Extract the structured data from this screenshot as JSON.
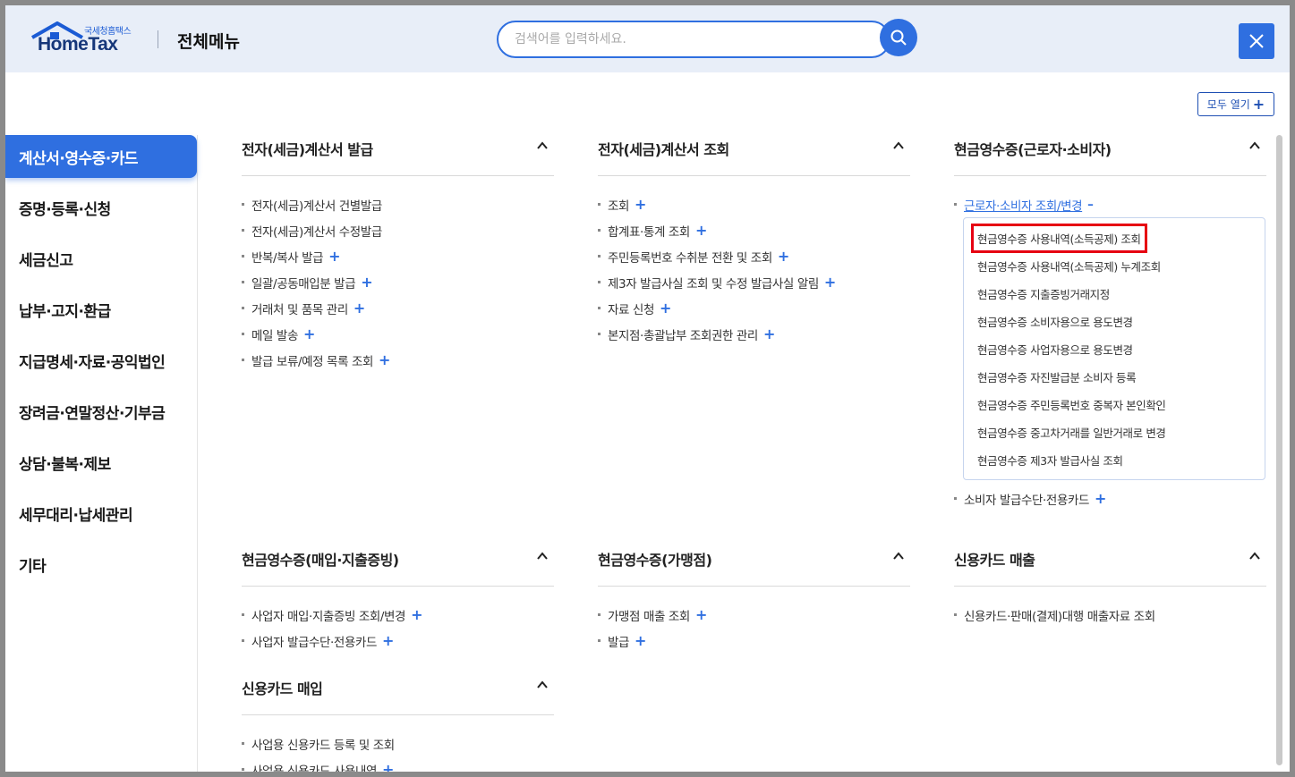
{
  "header": {
    "logo_small": "국세청홈택스",
    "logo_big": "HomeTax",
    "title": "전체메뉴",
    "search_placeholder": "검색어를 입력하세요.",
    "open_all": "모두 열기"
  },
  "sidebar": {
    "items": [
      {
        "label": "계산서·영수증·카드",
        "active": true
      },
      {
        "label": "증명·등록·신청"
      },
      {
        "label": "세금신고"
      },
      {
        "label": "납부·고지·환급"
      },
      {
        "label": "지급명세·자료·공익법인"
      },
      {
        "label": "장려금·연말정산·기부금"
      },
      {
        "label": "상담·불복·제보"
      },
      {
        "label": "세무대리·납세관리"
      },
      {
        "label": "기타"
      }
    ]
  },
  "sections": {
    "s1": {
      "title": "전자(세금)계산서 발급",
      "items": [
        "전자(세금)계산서 건별발급",
        "전자(세금)계산서 수정발급",
        "반복/복사 발급",
        "일괄/공동매입분 발급",
        "거래처 및 품목 관리",
        "메일 발송",
        "발급 보류/예정 목록 조회"
      ]
    },
    "s2": {
      "title": "전자(세금)계산서 조회",
      "items": [
        "조회",
        "합계표·통계 조회",
        "주민등록번호 수취분 전환 및 조회",
        "제3자 발급사실 조회 및 수정 발급사실 알림",
        "자료 신청",
        "본지점·총괄납부 조회권한 관리"
      ]
    },
    "s3": {
      "title": "현금영수증(근로자·소비자)",
      "open_item": "근로자·소비자 조회/변경",
      "sub_items": [
        "현금영수증 사용내역(소득공제) 조회",
        "현금영수증 사용내역(소득공제) 누계조회",
        "현금영수증 지출증빙거래지정",
        "현금영수증 소비자용으로 용도변경",
        "현금영수증 사업자용으로 용도변경",
        "현금영수증 자진발급분 소비자 등록",
        "현금영수증 주민등록번호 중복자 본인확인",
        "현금영수증 중고차거래를 일반거래로 변경",
        "현금영수증 제3자 발급사실 조회"
      ],
      "after_item": "소비자 발급수단·전용카드"
    },
    "s4": {
      "title": "현금영수증(매입·지출증빙)",
      "items": [
        "사업자 매입·지출증빙 조회/변경",
        "사업자 발급수단·전용카드"
      ]
    },
    "s5": {
      "title": "현금영수증(가맹점)",
      "items": [
        "가맹점 매출 조회",
        "발급"
      ]
    },
    "s6": {
      "title": "신용카드 매출",
      "items": [
        "신용카드·판매(결제)대행 매출자료 조회"
      ]
    },
    "s7": {
      "title": "신용카드 매입",
      "items": [
        "사업용 신용카드 등록 및 조회",
        "사업용 신용카드 사용내역"
      ]
    }
  },
  "colors": {
    "accent": "#2f6fe0",
    "highlight": "#e60012"
  }
}
